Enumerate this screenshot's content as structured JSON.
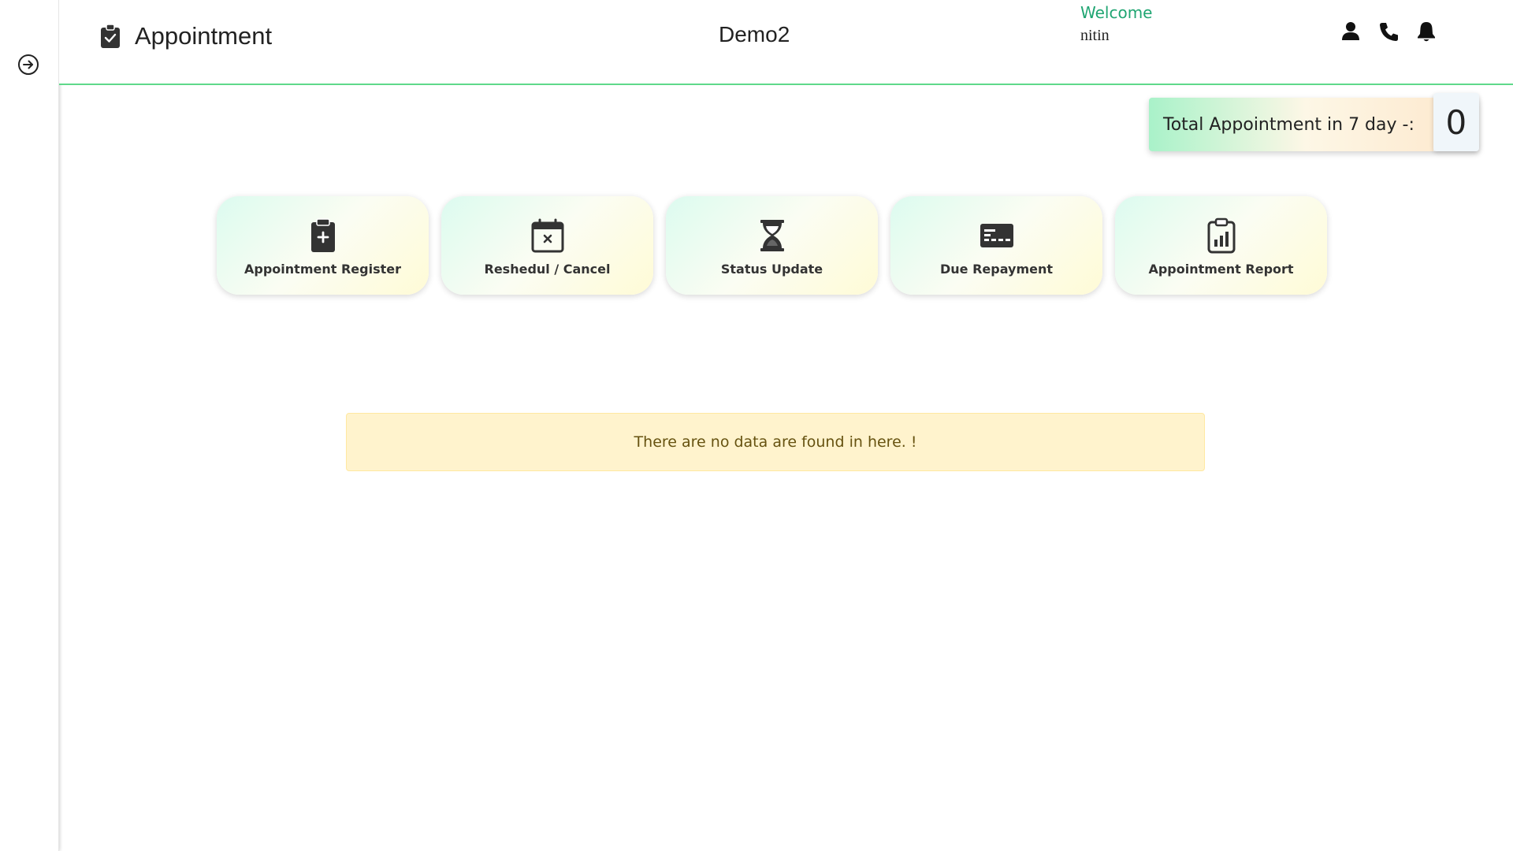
{
  "sidebar": {
    "toggle_icon": "arrow-right-circle-icon"
  },
  "header": {
    "title": "Appointment",
    "title_icon": "clipboard-check-icon",
    "org_name": "Demo2",
    "welcome": "Welcome",
    "username": "nitin",
    "icons": [
      "user-icon",
      "phone-icon",
      "bell-icon"
    ]
  },
  "summary": {
    "label": "Total Appointment in 7 day -:",
    "count": "0"
  },
  "actions": [
    {
      "label": "Appointment Register",
      "icon": "clipboard-plus-icon"
    },
    {
      "label": "Reshedul / Cancel",
      "icon": "calendar-x-icon"
    },
    {
      "label": "Status Update",
      "icon": "hourglass-icon"
    },
    {
      "label": "Due Repayment",
      "icon": "card-icon"
    },
    {
      "label": "Appointment Report",
      "icon": "clipboard-chart-icon"
    }
  ],
  "empty_message": "There are no data are found in here. !",
  "colors": {
    "accent_green": "#5fd98a",
    "welcome_green": "#1fa572",
    "alert_bg": "#fff3cd",
    "alert_text": "#665210"
  }
}
